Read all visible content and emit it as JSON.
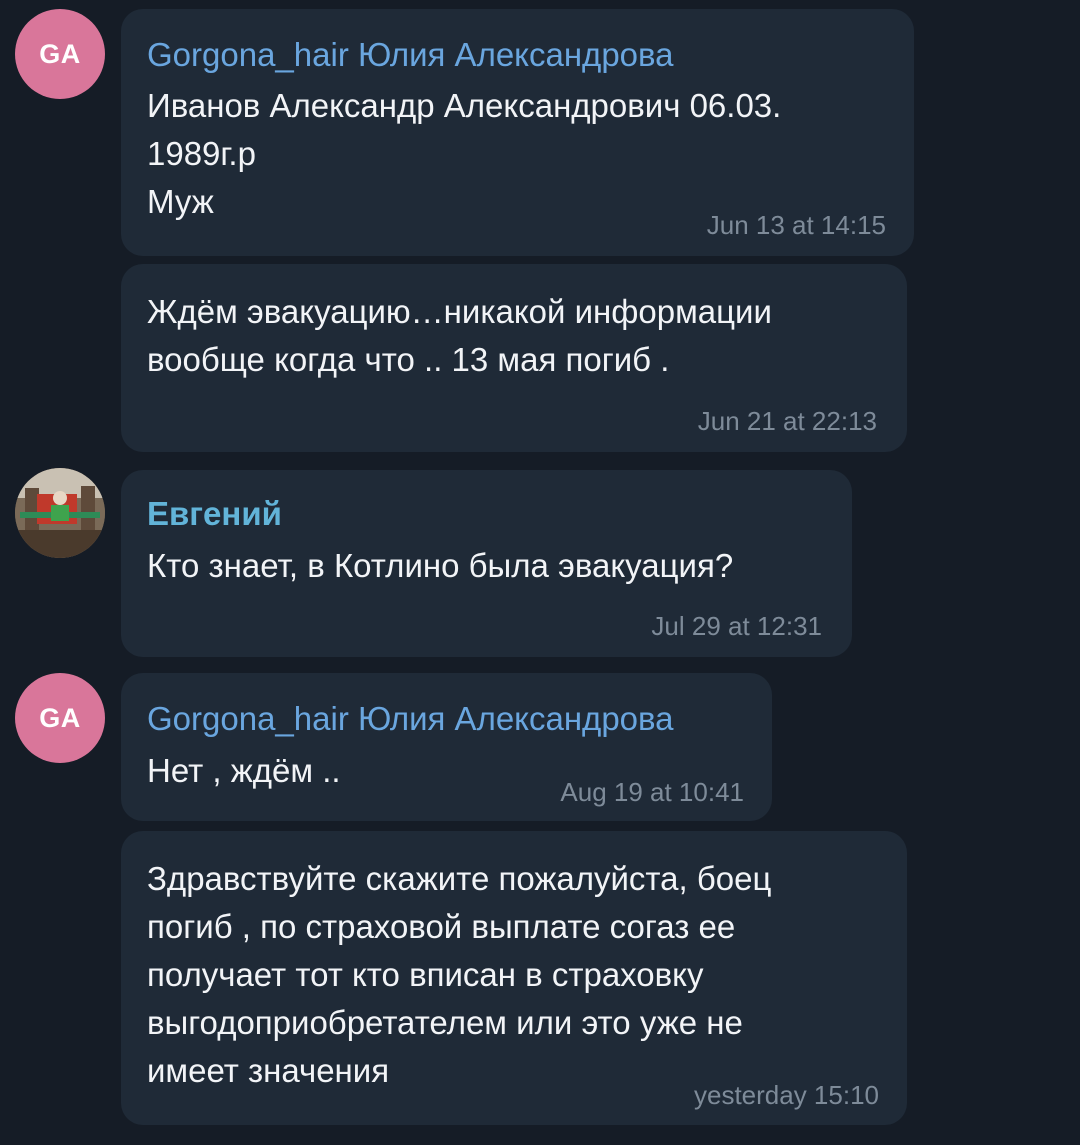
{
  "messages": [
    {
      "sender": "Gorgona_hair Юлия Александрова",
      "avatar_initials": "GA",
      "text": "Иванов Александр Александрович 06.03.\n1989г.р\nМуж",
      "time": "Jun 13 at 14:15"
    },
    {
      "text": "Ждём эвакуацию…никакой информации\nвообще когда что .. 13 мая погиб .",
      "time": "Jun 21 at 22:13"
    },
    {
      "sender": "Евгений",
      "text": "Кто знает, в Котлино была эвакуация?",
      "time": "Jul 29 at 12:31"
    },
    {
      "sender": "Gorgona_hair Юлия Александрова",
      "avatar_initials": "GA",
      "text": "Нет , ждём ..",
      "time": "Aug 19 at 10:41"
    },
    {
      "text": "Здравствуйте скажите пожалуйста, боец\nпогиб , по страховой выплате согаз ее\nполучает тот кто вписан в страховку\nвыгодоприобретателем или это уже не\nимеет значения",
      "time": "yesterday 15:10"
    }
  ],
  "colors": {
    "background": "#151c26",
    "bubble": "#1f2a37",
    "avatar_pink": "#d9769a",
    "name_gorgona": "#6aa6df",
    "name_evgeniy": "#62b4d9",
    "timestamp": "#7e8b99"
  }
}
